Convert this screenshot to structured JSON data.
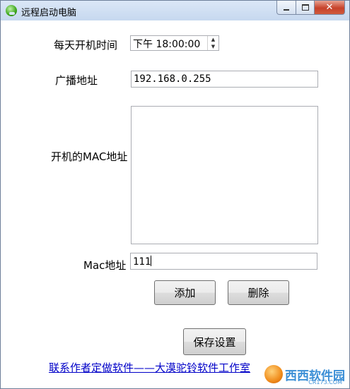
{
  "window": {
    "title": "远程启动电脑",
    "min_label": "",
    "max_label": "",
    "close_label": "✕"
  },
  "form": {
    "boot_time_label": "每天开机时间",
    "boot_time_value": "下午 18:00:00",
    "broadcast_label": "广播地址",
    "broadcast_value": "192.168.0.255",
    "mac_list_label": "开机的MAC地址",
    "mac_list_value": "",
    "mac_input_label": "Mac地址",
    "mac_input_value": "111"
  },
  "buttons": {
    "add": "添加",
    "delete": "删除",
    "save": "保存设置"
  },
  "link": {
    "text": "联系作者定做软件——大漠驼铃软件工作室"
  },
  "watermark": {
    "brand": "西西软件园",
    "domain": "CR173.COM"
  },
  "icons": {
    "app": "app-icon",
    "spin_up": "▲",
    "spin_down": "▼"
  }
}
